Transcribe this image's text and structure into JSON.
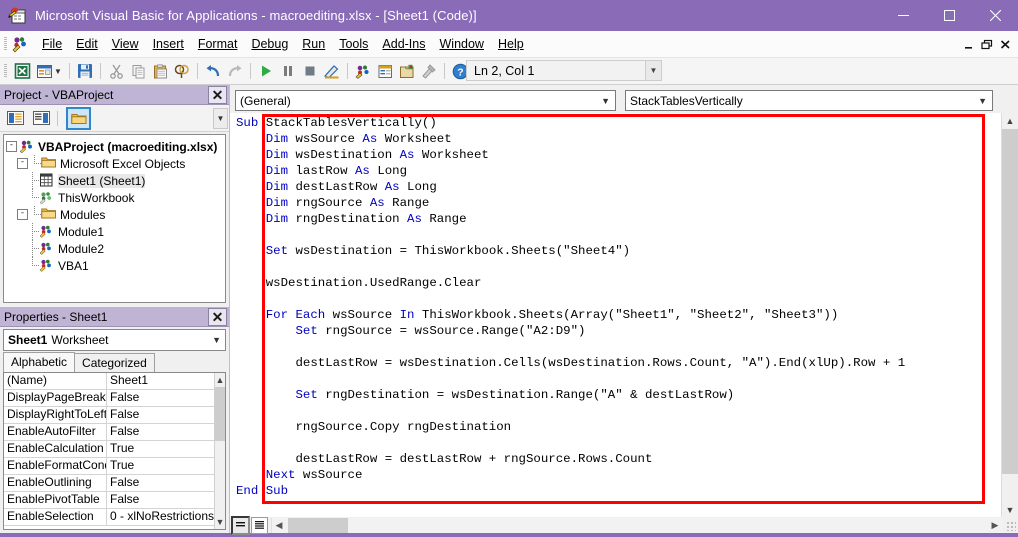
{
  "window": {
    "title": "Microsoft Visual Basic for Applications - macroediting.xlsx - [Sheet1 (Code)]",
    "app_icon": "vba-excel-icon",
    "minimize": "—",
    "maximize": "☐",
    "close": "✕"
  },
  "menu": {
    "app_icon": "vba-project-icon",
    "items": [
      {
        "label": "File",
        "accel": "F"
      },
      {
        "label": "Edit",
        "accel": "E"
      },
      {
        "label": "View",
        "accel": "V"
      },
      {
        "label": "Insert",
        "accel": "I"
      },
      {
        "label": "Format",
        "accel": "o"
      },
      {
        "label": "Debug",
        "accel": "D"
      },
      {
        "label": "Run",
        "accel": "R"
      },
      {
        "label": "Tools",
        "accel": "T"
      },
      {
        "label": "Add-Ins",
        "accel": "A"
      },
      {
        "label": "Window",
        "accel": "W"
      },
      {
        "label": "Help",
        "accel": "H"
      }
    ],
    "mdi": {
      "minimize": "_",
      "restore": "❐",
      "close": "✕"
    }
  },
  "toolbar": {
    "buttons": [
      {
        "name": "view-excel-icon",
        "title": "View Microsoft Excel"
      },
      {
        "name": "insert-userform-icon",
        "title": "Insert UserForm"
      },
      {
        "name": "save-icon",
        "title": "Save macroediting.xlsx"
      },
      {
        "name": "cut-icon",
        "title": "Cut"
      },
      {
        "name": "copy-icon",
        "title": "Copy"
      },
      {
        "name": "paste-icon",
        "title": "Paste"
      },
      {
        "name": "find-icon",
        "title": "Find"
      },
      {
        "name": "undo-icon",
        "title": "Undo"
      },
      {
        "name": "redo-icon",
        "title": "Redo"
      },
      {
        "name": "run-icon",
        "title": "Run Sub/UserForm"
      },
      {
        "name": "break-icon",
        "title": "Break"
      },
      {
        "name": "reset-icon",
        "title": "Reset"
      },
      {
        "name": "design-mode-icon",
        "title": "Design Mode"
      },
      {
        "name": "project-explorer-icon",
        "title": "Project Explorer"
      },
      {
        "name": "properties-window-icon",
        "title": "Properties Window"
      },
      {
        "name": "object-browser-icon",
        "title": "Object Browser"
      },
      {
        "name": "toolbox-icon",
        "title": "Toolbox"
      },
      {
        "name": "help-icon",
        "title": "Help"
      }
    ],
    "status": "Ln 2, Col 1"
  },
  "project_panel": {
    "title": "Project - VBAProject",
    "close_label": "✕",
    "toolbar": [
      {
        "name": "view-code-button",
        "label": "View Code"
      },
      {
        "name": "view-object-button",
        "label": "View Object"
      },
      {
        "name": "toggle-folders-button",
        "label": "Toggle Folders"
      }
    ],
    "tree": [
      {
        "label": "VBAProject (macroediting.xlsx)",
        "icon": "vbaproject-icon",
        "level": 0,
        "bold": true,
        "expander": "-"
      },
      {
        "label": "Microsoft Excel Objects",
        "icon": "folder-icon",
        "level": 1,
        "bold": false,
        "expander": "-"
      },
      {
        "label": "Sheet1 (Sheet1)",
        "icon": "worksheet-icon",
        "level": 2,
        "bold": false,
        "expander": "",
        "selected": true
      },
      {
        "label": "ThisWorkbook",
        "icon": "workbook-icon",
        "level": 2,
        "bold": false,
        "expander": ""
      },
      {
        "label": "Modules",
        "icon": "folder-icon",
        "level": 1,
        "bold": false,
        "expander": "-"
      },
      {
        "label": "Module1",
        "icon": "module-icon",
        "level": 2,
        "bold": false,
        "expander": ""
      },
      {
        "label": "Module2",
        "icon": "module-icon",
        "level": 2,
        "bold": false,
        "expander": ""
      },
      {
        "label": "VBA1",
        "icon": "module-icon",
        "level": 2,
        "bold": false,
        "expander": ""
      }
    ]
  },
  "properties_panel": {
    "title": "Properties - Sheet1",
    "close_label": "✕",
    "object_bold": "Sheet1",
    "object_type": "Worksheet",
    "tabs": [
      {
        "label": "Alphabetic",
        "active": true
      },
      {
        "label": "Categorized",
        "active": false
      }
    ],
    "rows": [
      {
        "name": "(Name)",
        "value": "Sheet1"
      },
      {
        "name": "DisplayPageBreaks",
        "value": "False"
      },
      {
        "name": "DisplayRightToLeft",
        "value": "False"
      },
      {
        "name": "EnableAutoFilter",
        "value": "False"
      },
      {
        "name": "EnableCalculation",
        "value": "True"
      },
      {
        "name": "EnableFormatConditi",
        "value": "True"
      },
      {
        "name": "EnableOutlining",
        "value": "False"
      },
      {
        "name": "EnablePivotTable",
        "value": "False"
      },
      {
        "name": "EnableSelection",
        "value": "0 - xlNoRestrictions"
      }
    ]
  },
  "code_window": {
    "object_dropdown": "(General)",
    "procedure_dropdown": "StackTablesVertically",
    "view_buttons": [
      {
        "name": "procedure-view-button",
        "selected": true
      },
      {
        "name": "full-module-view-button",
        "selected": false
      }
    ],
    "annotation_color": "#ff0000",
    "lines": [
      [
        {
          "t": "Sub ",
          "k": true
        },
        {
          "t": "StackTablesVertically()",
          "k": false
        }
      ],
      [
        {
          "t": "    Dim ",
          "k": true
        },
        {
          "t": "wsSource ",
          "k": false
        },
        {
          "t": "As ",
          "k": true
        },
        {
          "t": "Worksheet",
          "k": false
        }
      ],
      [
        {
          "t": "    Dim ",
          "k": true
        },
        {
          "t": "wsDestination ",
          "k": false
        },
        {
          "t": "As ",
          "k": true
        },
        {
          "t": "Worksheet",
          "k": false
        }
      ],
      [
        {
          "t": "    Dim ",
          "k": true
        },
        {
          "t": "lastRow ",
          "k": false
        },
        {
          "t": "As ",
          "k": true
        },
        {
          "t": "Long",
          "k": false
        }
      ],
      [
        {
          "t": "    Dim ",
          "k": true
        },
        {
          "t": "destLastRow ",
          "k": false
        },
        {
          "t": "As ",
          "k": true
        },
        {
          "t": "Long",
          "k": false
        }
      ],
      [
        {
          "t": "    Dim ",
          "k": true
        },
        {
          "t": "rngSource ",
          "k": false
        },
        {
          "t": "As ",
          "k": true
        },
        {
          "t": "Range",
          "k": false
        }
      ],
      [
        {
          "t": "    Dim ",
          "k": true
        },
        {
          "t": "rngDestination ",
          "k": false
        },
        {
          "t": "As ",
          "k": true
        },
        {
          "t": "Range",
          "k": false
        }
      ],
      [],
      [
        {
          "t": "    Set ",
          "k": true
        },
        {
          "t": "wsDestination = ThisWorkbook.Sheets(\"Sheet4\")",
          "k": false
        }
      ],
      [],
      [
        {
          "t": "    wsDestination.UsedRange.Clear",
          "k": false
        }
      ],
      [],
      [
        {
          "t": "    For Each ",
          "k": true
        },
        {
          "t": "wsSource ",
          "k": false
        },
        {
          "t": "In ",
          "k": true
        },
        {
          "t": "ThisWorkbook.Sheets(Array(\"Sheet1\", \"Sheet2\", \"Sheet3\"))",
          "k": false
        }
      ],
      [
        {
          "t": "        Set ",
          "k": true
        },
        {
          "t": "rngSource = wsSource.Range(\"A2:D9\")",
          "k": false
        }
      ],
      [],
      [
        {
          "t": "        destLastRow = wsDestination.Cells(wsDestination.Rows.Count, \"A\").End(xlUp).Row + 1",
          "k": false
        }
      ],
      [],
      [
        {
          "t": "        Set ",
          "k": true
        },
        {
          "t": "rngDestination = wsDestination.Range(\"A\" & destLastRow)",
          "k": false
        }
      ],
      [],
      [
        {
          "t": "        rngSource.Copy rngDestination",
          "k": false
        }
      ],
      [],
      [
        {
          "t": "        destLastRow = destLastRow + rngSource.Rows.Count",
          "k": false
        }
      ],
      [
        {
          "t": "    Next ",
          "k": true
        },
        {
          "t": "wsSource",
          "k": false
        }
      ],
      [
        {
          "t": "End Sub",
          "k": true
        }
      ]
    ]
  }
}
